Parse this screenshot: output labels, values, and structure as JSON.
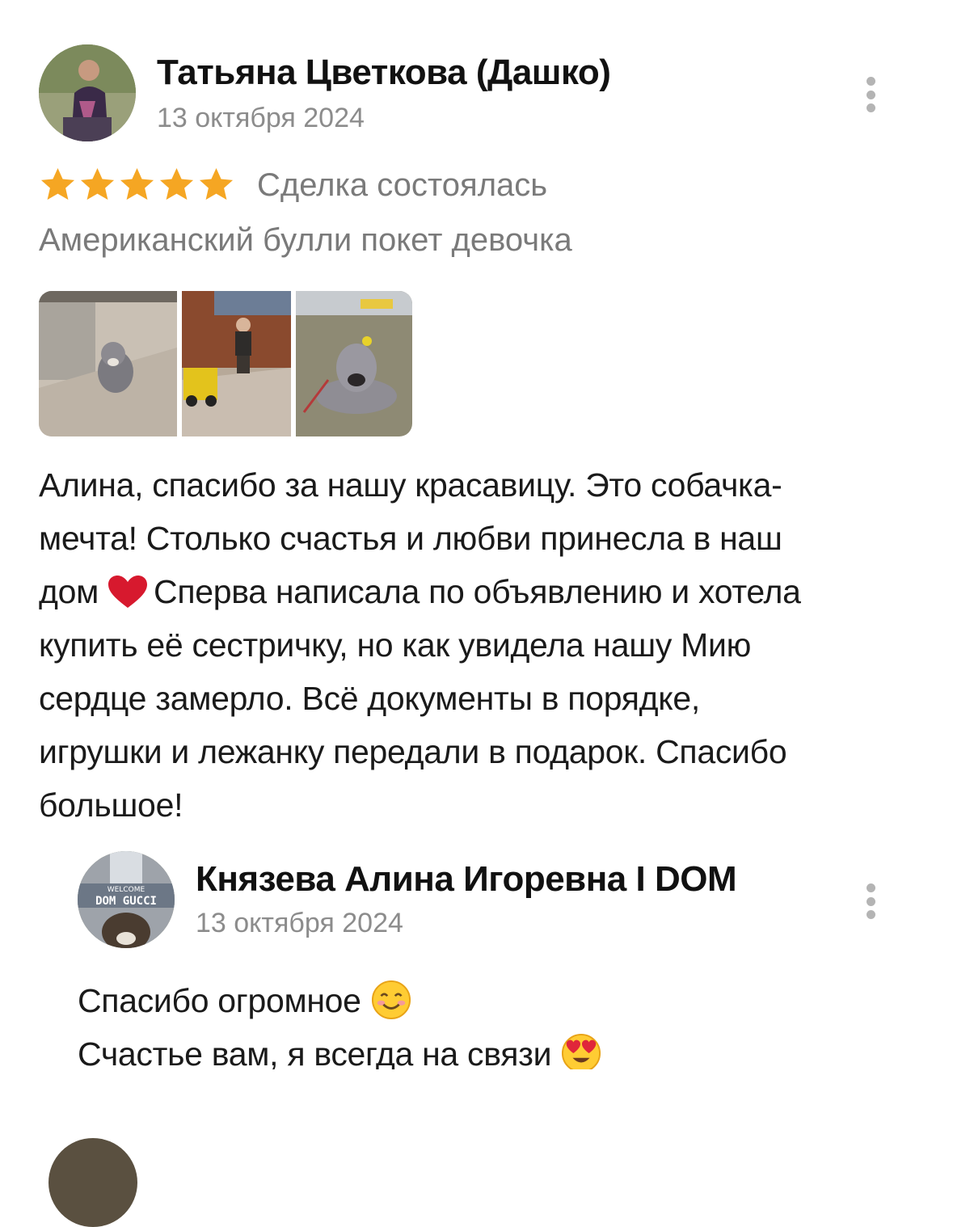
{
  "review": {
    "author": "Татьяна Цветкова (Дашко)",
    "date": "13 октября 2024",
    "rating": 5,
    "rating_max": 5,
    "status": "Сделка состоялась",
    "item": "Американский булли покет девочка",
    "photos_count": 3,
    "text_lines": [
      "Алина, спасибо за нашу красавицу. Это собачка-",
      "мечта! Столько счастья и любви принесла в наш",
      "дом",
      "Сперва написала по объявлению и хотела",
      "купить её сестричку, но как увидела нашу Мию",
      "сердце замерло. Всё документы в порядке,",
      "игрушки и лежанку передали в подарок. Спасибо",
      "большое!"
    ],
    "icons": [
      "avatar",
      "more-vertical-icon",
      "star-icon",
      "heart-emoji-icon"
    ],
    "colors": {
      "star": "#F5A623",
      "heart": "#D7192E",
      "muted_text": "#7A7A7A"
    }
  },
  "reply": {
    "author": "Князева Алина Игоревна I DOM",
    "date": "13 октября 2024",
    "avatar_text": [
      "WELCOME",
      "DOM GUCCI"
    ],
    "text_lines": [
      "Спасибо огромное",
      "Счастье вам, я всегда на связи"
    ],
    "icons": [
      "smiling-face-emoji-icon",
      "heart-eyes-emoji-icon"
    ]
  }
}
